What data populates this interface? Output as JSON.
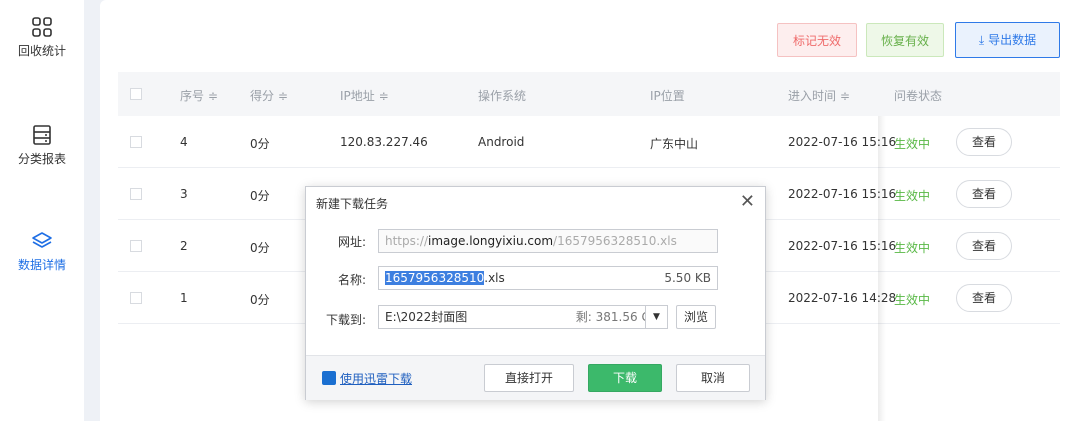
{
  "sidebar": {
    "items": [
      {
        "label": "回收统计",
        "icon": "grid-icon"
      },
      {
        "label": "分类报表",
        "icon": "table-icon"
      },
      {
        "label": "数据详情",
        "icon": "layers-icon"
      }
    ],
    "active": "数据详情"
  },
  "toolbar": {
    "mark_invalid": "标记无效",
    "restore_valid": "恢复有效",
    "export_data": "导出数据"
  },
  "table": {
    "headers": {
      "index": "序号 ≑",
      "score": "得分 ≑",
      "ip": "IP地址 ≑",
      "os": "操作系统",
      "location": "IP位置",
      "enter_time": "进入时间 ≑",
      "status": "问卷状态"
    },
    "rows": [
      {
        "index": "4",
        "score": "0分",
        "ip": "120.83.227.46",
        "os": "Android",
        "location": "广东中山",
        "time": "2022-07-16 15:16",
        "status": "生效中",
        "action": "查看"
      },
      {
        "index": "3",
        "score": "0分",
        "ip": "",
        "os": "",
        "location": "",
        "time": "2022-07-16 15:16",
        "status": "生效中",
        "action": "查看"
      },
      {
        "index": "2",
        "score": "0分",
        "ip": "",
        "os": "",
        "location": "",
        "time": "2022-07-16 15:16",
        "status": "生效中",
        "action": "查看"
      },
      {
        "index": "1",
        "score": "0分",
        "ip": "",
        "os": "",
        "location": "",
        "time": "2022-07-16 14:28",
        "status": "生效中",
        "action": "查看"
      }
    ]
  },
  "dialog": {
    "title": "新建下载任务",
    "url_label": "网址:",
    "url_prefix": "https://",
    "url_host": "image.longyixiu.com",
    "url_path": "/1657956328510.xls",
    "name_label": "名称:",
    "name_selected": "1657956328510",
    "name_ext": ".xls",
    "file_size": "5.50 KB",
    "save_label": "下载到:",
    "save_path": "E:\\2022封面图",
    "free_space": "剩: 381.56 GB",
    "browse": "浏览",
    "thunder_link": "使用迅雷下载",
    "open_direct": "直接打开",
    "download": "下载",
    "cancel": "取消"
  },
  "colors": {
    "accent": "#2f7ae8",
    "status_green": "#58b845",
    "danger": "#ef6b6b",
    "download_green": "#3cb96b"
  }
}
